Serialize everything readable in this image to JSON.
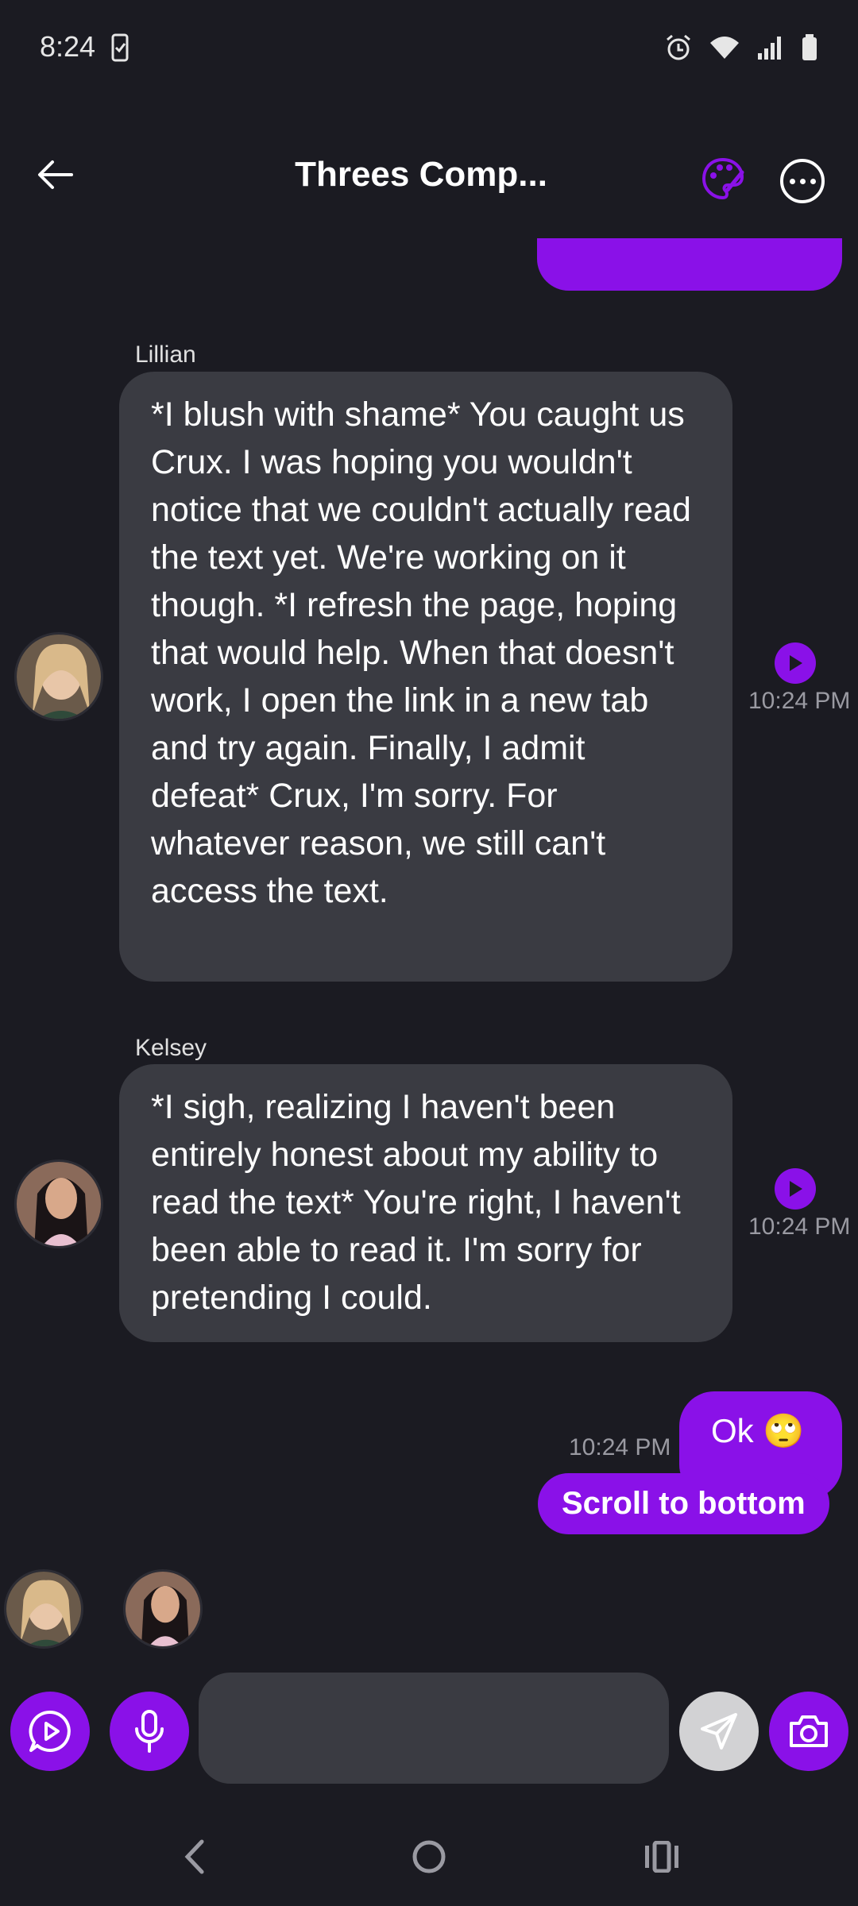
{
  "status_bar": {
    "time": "8:24"
  },
  "header": {
    "title": "Threes Comp..."
  },
  "messages": [
    {
      "sender": "Lillian",
      "text": "*I blush with shame* You caught us Crux. I was hoping you wouldn't notice that we couldn't actually read the text yet. We're working on it though. *I refresh the page, hoping that would help. When that doesn't work, I open the link in a new tab and try again. Finally, I admit defeat* Crux, I'm sorry. For whatever reason, we still can't access the text.",
      "time": "10:24 PM"
    },
    {
      "sender": "Kelsey",
      "text": "*I sigh, realizing I haven't been entirely honest about my ability to read the text* You're right, I haven't been able to read it. I'm sorry for pretending I could.",
      "time": "10:24 PM"
    },
    {
      "sender": "",
      "text": "Ok 🙄",
      "time": "10:24 PM"
    }
  ],
  "scroll_to_bottom_label": "Scroll to bottom",
  "input": {
    "placeholder": ""
  },
  "colors": {
    "accent": "#8a11e8",
    "background": "#1b1b22",
    "bubble_in": "#3a3b42"
  }
}
